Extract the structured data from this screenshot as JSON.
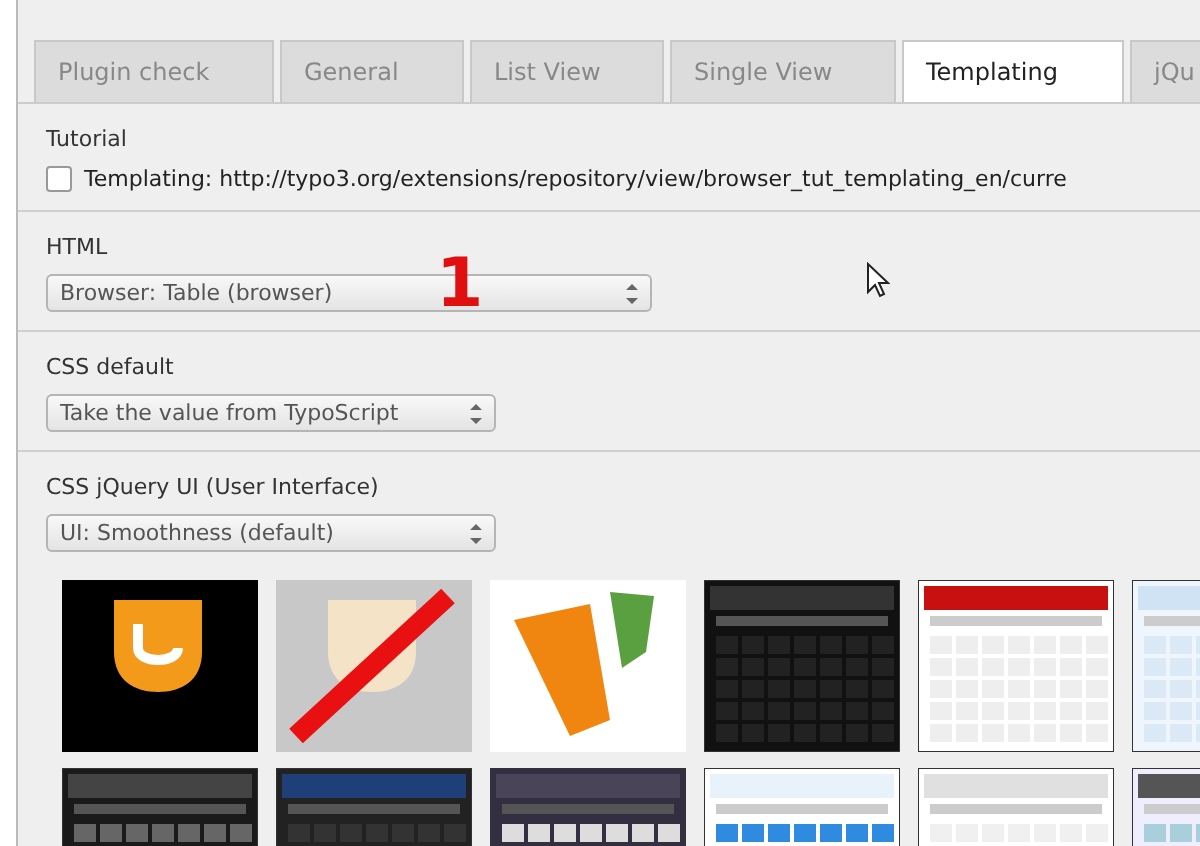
{
  "tabs": [
    {
      "label": "Plugin check",
      "selected": false
    },
    {
      "label": "General",
      "selected": false
    },
    {
      "label": "List View",
      "selected": false
    },
    {
      "label": "Single View",
      "selected": false
    },
    {
      "label": "Templating",
      "selected": true
    },
    {
      "label": "jQu",
      "selected": false
    }
  ],
  "tutorial": {
    "heading": "Tutorial",
    "checkbox": {
      "label": "Templating: http://typo3.org/extensions/repository/view/browser_tut_templating_en/curre",
      "checked": false
    }
  },
  "html": {
    "heading": "HTML",
    "value": "Browser: Table (browser)"
  },
  "annotation": "1",
  "css_default": {
    "heading": "CSS default",
    "value": "Take the value from TypoScript"
  },
  "css_jquery_ui": {
    "heading": "CSS jQuery UI (User Interface)",
    "value": "UI: Smoothness (default)"
  }
}
